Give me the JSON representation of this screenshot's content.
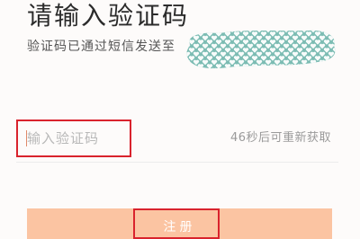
{
  "header": {
    "title": "请输入验证码",
    "subtitle": "验证码已通过短信发送至"
  },
  "phone_mask": {
    "icon": "heart-pattern-mask",
    "fill_color": "#7cbcb3",
    "pattern_color": "#ffffff"
  },
  "code_field": {
    "placeholder": "输入验证码",
    "value": ""
  },
  "resend": {
    "text": "46秒后可重新获取"
  },
  "register": {
    "label": "注册",
    "color": "#fbc4a2"
  },
  "annotation_color": "#d9232d"
}
